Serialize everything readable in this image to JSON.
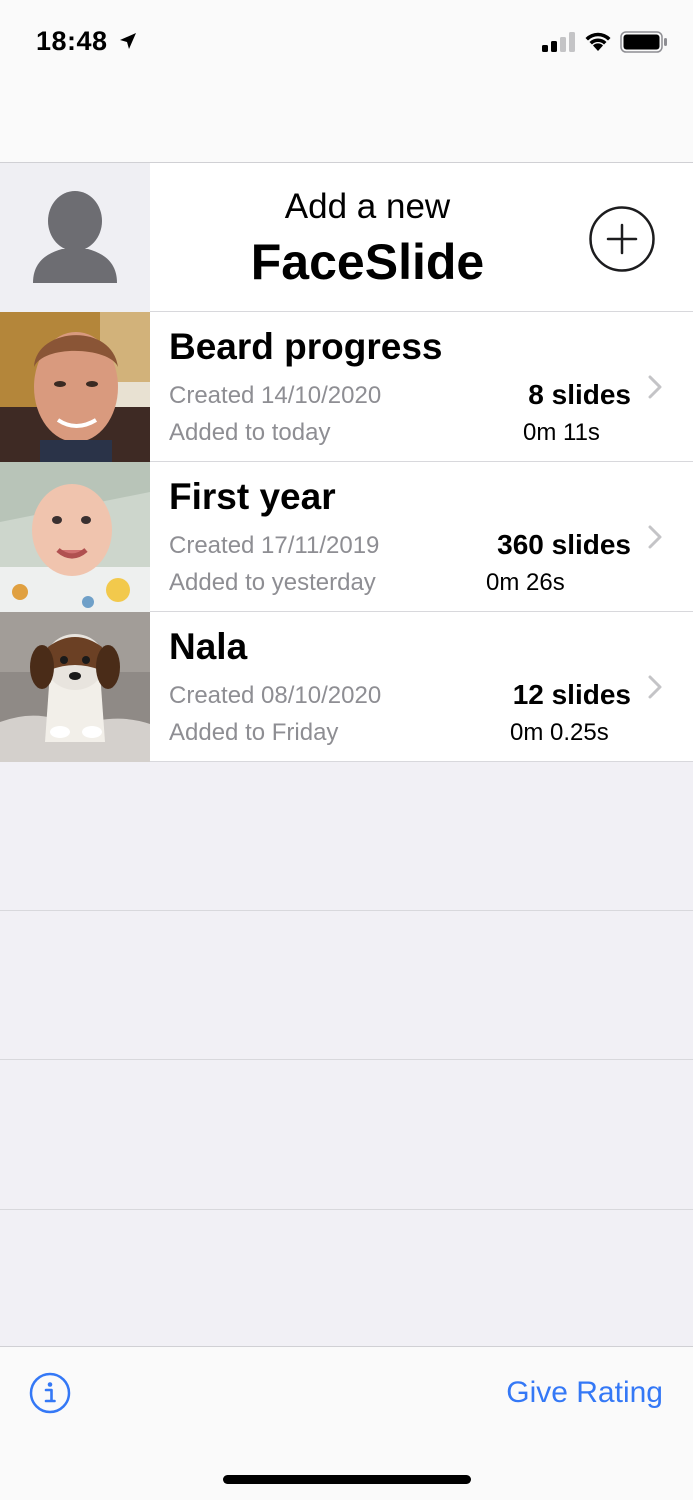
{
  "status": {
    "time": "18:48",
    "icons": [
      "location-arrow-icon",
      "cellular-signal-icon",
      "wifi-icon",
      "battery-icon"
    ]
  },
  "add_row": {
    "line1": "Add a new",
    "line2": "FaceSlide",
    "avatar_icon": "person-placeholder-icon",
    "button_icon": "plus-circle-icon"
  },
  "rows": [
    {
      "title": "Beard progress",
      "created": "Created 14/10/2020",
      "added": "Added to today",
      "slides": "8 slides",
      "duration": "0m 11s",
      "thumb": "man-face-photo"
    },
    {
      "title": "First year",
      "created": "Created 17/11/2019",
      "added": "Added to yesterday",
      "slides": "360 slides",
      "duration": "0m 26s",
      "thumb": "baby-face-photo"
    },
    {
      "title": "Nala",
      "created": "Created 08/10/2020",
      "added": "Added to Friday",
      "slides": "12 slides",
      "duration": "0m 0.25s",
      "thumb": "beagle-puppy-photo"
    }
  ],
  "toolbar": {
    "info_icon": "info-circle-icon",
    "rating_label": "Give Rating"
  },
  "colors": {
    "accent": "#3478f6",
    "secondary_text": "#8e8e93",
    "background": "#f1f0f5"
  }
}
